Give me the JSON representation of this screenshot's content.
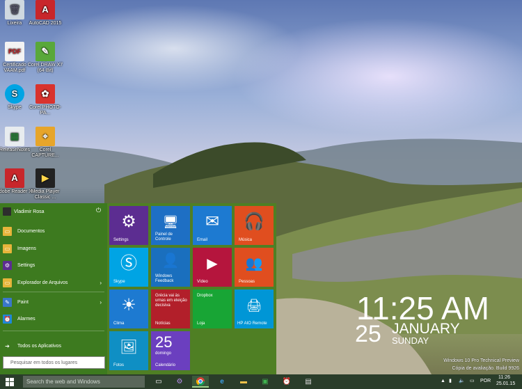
{
  "desktop": {
    "icons": [
      {
        "label": "Lixeira",
        "icon": "recycle-bin-icon"
      },
      {
        "label": "AutoCAD 2015",
        "icon": "autocad-icon"
      },
      {
        "label": "Certificado VAAM.pdf",
        "icon": "pdf-file-icon"
      },
      {
        "label": "Corel DRAW X7 (64-Bit)",
        "icon": "coreldraw-icon"
      },
      {
        "label": "Skype",
        "icon": "skype-icon"
      },
      {
        "label": "Corel PHOTO-PA...",
        "icon": "corel-photopaint-icon"
      },
      {
        "label": "ReleaseNotes",
        "icon": "release-notes-icon"
      },
      {
        "label": "Corel CAPTURE...",
        "icon": "corel-capture-icon"
      },
      {
        "label": "Adobe Reader XI",
        "icon": "adobe-reader-icon"
      },
      {
        "label": "Media Player Classic ...",
        "icon": "media-player-icon"
      }
    ]
  },
  "start_menu": {
    "user_name": "Vladimir Rosa",
    "power_glyph": "⏻",
    "items": [
      {
        "label": "Documentos",
        "icon": "folder-documents-icon",
        "color": "#e7b53b"
      },
      {
        "label": "Imagens",
        "icon": "folder-pictures-icon",
        "color": "#e7b53b"
      },
      {
        "label": "Settings",
        "icon": "gear-icon",
        "color": "#5c2d91"
      },
      {
        "label": "Explorador de Arquivos",
        "icon": "file-explorer-icon",
        "color": "#e7b53b"
      },
      {
        "label": "Paint",
        "icon": "paint-icon",
        "color": "#3a77c9"
      },
      {
        "label": "Alarmes",
        "icon": "alarm-clock-icon",
        "color": "#1e88d9"
      }
    ],
    "all_apps": "Todos os Aplicativos",
    "search_placeholder": "Pesquisar em todos os lugares",
    "tiles": [
      {
        "label": "Settings",
        "color": "#5c2d91",
        "icon": "gear-icon"
      },
      {
        "label": "Painel de Controle",
        "color": "#1e6fc4",
        "icon": "control-panel-icon"
      },
      {
        "label": "Email",
        "color": "#1d7ad1",
        "icon": "mail-icon"
      },
      {
        "label": "Música",
        "color": "#e04e1f",
        "icon": "headphones-icon"
      },
      {
        "label": "Skype",
        "color": "#00a4e4",
        "icon": "skype-icon"
      },
      {
        "label": "Windows Feedback",
        "color": "#1a6fbe",
        "icon": "feedback-icon"
      },
      {
        "label": "Vídeo",
        "color": "#b5153d",
        "icon": "video-icon"
      },
      {
        "label": "Pessoas",
        "color": "#e04e1f",
        "icon": "people-icon"
      },
      {
        "label": "Clima",
        "color": "#1d7ad1",
        "icon": "sun-icon"
      },
      {
        "label": "Notícias",
        "color": "#b21f2a",
        "icon": "news-icon",
        "headline": "Grécia vai às urnas em eleição decisiva"
      },
      {
        "label": "Loja",
        "color": "#18a535",
        "icon": "store-icon",
        "top_text": "Dropbox"
      },
      {
        "label": "HP AIO Remote",
        "color": "#0096d6",
        "icon": "hp-icon"
      },
      {
        "label": "Fotos",
        "color": "#0f8fc4",
        "icon": "photos-icon"
      },
      {
        "label": "Calendário",
        "color": "#6b3fbf",
        "icon": "calendar-icon",
        "day": "25",
        "weekday": "domingo"
      }
    ]
  },
  "clock": {
    "time": "11:25 AM",
    "day": "25",
    "month": "JANUARY",
    "weekday": "SUNDAY"
  },
  "watermark": {
    "line1": "Windows 10 Pro Technical Preview",
    "line2": "Cópia de avaliação. Build 9926"
  },
  "taskbar": {
    "search_placeholder": "Search the web and Windows",
    "apps": [
      {
        "icon": "task-view-icon"
      },
      {
        "icon": "settings-icon"
      },
      {
        "icon": "chrome-icon"
      },
      {
        "icon": "internet-explorer-icon"
      },
      {
        "icon": "file-explorer-icon"
      },
      {
        "icon": "store-icon"
      },
      {
        "icon": "alarm-icon"
      },
      {
        "icon": "media-player-icon"
      }
    ],
    "tray": {
      "language": "POR",
      "time": "11:26",
      "date": "25.01.15"
    }
  }
}
